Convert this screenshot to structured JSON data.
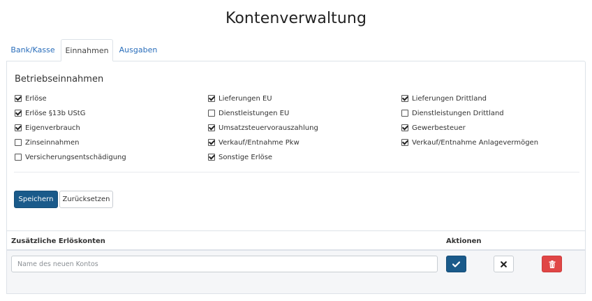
{
  "page": {
    "title": "Kontenverwaltung"
  },
  "tabs": [
    {
      "label": "Bank/Kasse",
      "active": false
    },
    {
      "label": "Einnahmen",
      "active": true
    },
    {
      "label": "Ausgaben",
      "active": false
    }
  ],
  "section": {
    "title": "Betriebseinnahmen"
  },
  "columns": [
    [
      {
        "label": "Erlöse",
        "checked": true
      },
      {
        "label": "Erlöse §13b UStG",
        "checked": true
      },
      {
        "label": "Eigenverbrauch",
        "checked": true
      },
      {
        "label": "Zinseinnahmen",
        "checked": false
      },
      {
        "label": "Versicherungsentschädigung",
        "checked": false
      }
    ],
    [
      {
        "label": "Lieferungen EU",
        "checked": true
      },
      {
        "label": "Dienstleistungen EU",
        "checked": false
      },
      {
        "label": "Umsatzsteuervorauszahlung",
        "checked": true
      },
      {
        "label": "Verkauf/Entnahme Pkw",
        "checked": true
      },
      {
        "label": "Sonstige Erlöse",
        "checked": true
      }
    ],
    [
      {
        "label": "Lieferungen Drittland",
        "checked": true
      },
      {
        "label": "Dienstleistungen Drittland",
        "checked": false
      },
      {
        "label": "Gewerbesteuer",
        "checked": true
      },
      {
        "label": "Verkauf/Entnahme Anlagevermögen",
        "checked": true
      }
    ]
  ],
  "actions": {
    "save_label": "Speichern",
    "reset_label": "Zurücksetzen"
  },
  "table": {
    "col_accounts": "Zusätzliche Erlöskonten",
    "col_actions": "Aktionen",
    "new_account_placeholder": "Name des neuen Kontos",
    "new_account_value": ""
  },
  "icons": {
    "confirm": "check-icon",
    "cancel": "times-icon",
    "delete": "trash-icon"
  },
  "colors": {
    "primary": "#1a5a8a",
    "danger": "#e04646",
    "link": "#2a6ebb"
  }
}
